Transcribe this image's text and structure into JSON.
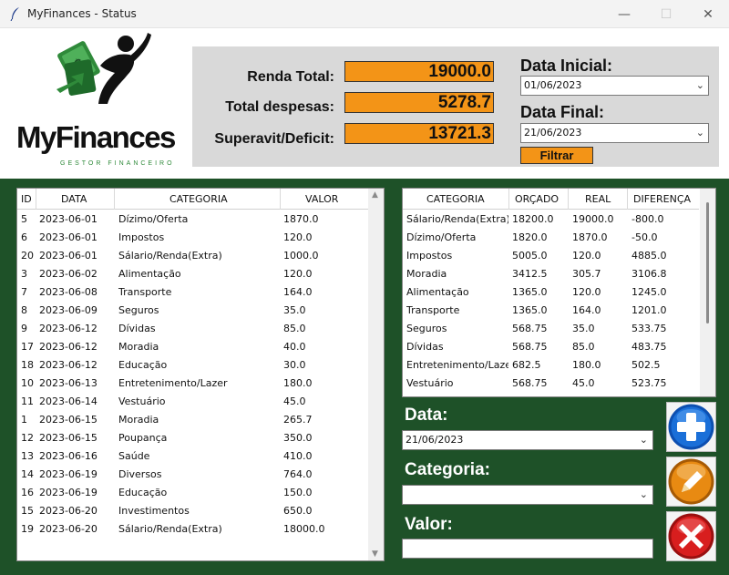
{
  "window": {
    "title": "MyFinances - Status",
    "minimize_label": "—",
    "maximize_label": "☐",
    "close_label": "✕"
  },
  "logo": {
    "name": "MyFinances",
    "tagline": "GESTOR FINANCEIRO"
  },
  "summary": {
    "renda_label": "Renda Total:",
    "renda_value": "19000.0",
    "despesas_label": "Total despesas:",
    "despesas_value": "5278.7",
    "superavit_label": "Superavit/Deficit:",
    "superavit_value": "13721.3"
  },
  "filter": {
    "data_inicial_label": "Data Inicial:",
    "data_inicial_value": "01/06/2023",
    "data_final_label": "Data Final:",
    "data_final_value": "21/06/2023",
    "filtrar_label": "Filtrar"
  },
  "transactions": {
    "headers": [
      "ID",
      "DATA",
      "CATEGORIA",
      "VALOR"
    ],
    "rows": [
      [
        "5",
        "2023-06-01",
        "Dízimo/Oferta",
        "1870.0"
      ],
      [
        "6",
        "2023-06-01",
        "Impostos",
        "120.0"
      ],
      [
        "20",
        "2023-06-01",
        "Sálario/Renda(Extra)",
        "1000.0"
      ],
      [
        "3",
        "2023-06-02",
        "Alimentação",
        "120.0"
      ],
      [
        "7",
        "2023-06-08",
        "Transporte",
        "164.0"
      ],
      [
        "8",
        "2023-06-09",
        "Seguros",
        "35.0"
      ],
      [
        "9",
        "2023-06-12",
        "Dívidas",
        "85.0"
      ],
      [
        "17",
        "2023-06-12",
        "Moradia",
        "40.0"
      ],
      [
        "18",
        "2023-06-12",
        "Educação",
        "30.0"
      ],
      [
        "10",
        "2023-06-13",
        "Entretenimento/Lazer",
        "180.0"
      ],
      [
        "11",
        "2023-06-14",
        "Vestuário",
        "45.0"
      ],
      [
        "1",
        "2023-06-15",
        "Moradia",
        "265.7"
      ],
      [
        "12",
        "2023-06-15",
        "Poupança",
        "350.0"
      ],
      [
        "13",
        "2023-06-16",
        "Saúde",
        "410.0"
      ],
      [
        "14",
        "2023-06-19",
        "Diversos",
        "764.0"
      ],
      [
        "16",
        "2023-06-19",
        "Educação",
        "150.0"
      ],
      [
        "15",
        "2023-06-20",
        "Investimentos",
        "650.0"
      ],
      [
        "19",
        "2023-06-20",
        "Sálario/Renda(Extra)",
        "18000.0"
      ]
    ]
  },
  "budget": {
    "headers": [
      "CATEGORIA",
      "ORÇADO",
      "REAL",
      "DIFERENÇA"
    ],
    "rows": [
      [
        "Sálario/Renda(Extra)",
        "18200.0",
        "19000.0",
        "-800.0"
      ],
      [
        "Dízimo/Oferta",
        "1820.0",
        "1870.0",
        "-50.0"
      ],
      [
        "Impostos",
        "5005.0",
        "120.0",
        "4885.0"
      ],
      [
        "Moradia",
        "3412.5",
        "305.7",
        "3106.8"
      ],
      [
        "Alimentação",
        "1365.0",
        "120.0",
        "1245.0"
      ],
      [
        "Transporte",
        "1365.0",
        "164.0",
        "1201.0"
      ],
      [
        "Seguros",
        "568.75",
        "35.0",
        "533.75"
      ],
      [
        "Dívidas",
        "568.75",
        "85.0",
        "483.75"
      ],
      [
        "Entretenimento/Lazer",
        "682.5",
        "180.0",
        "502.5"
      ],
      [
        "Vestuário",
        "568.75",
        "45.0",
        "523.75"
      ]
    ]
  },
  "form": {
    "data_label": "Data:",
    "data_value": "21/06/2023",
    "categoria_label": "Categoria:",
    "categoria_value": "",
    "valor_label": "Valor:",
    "valor_value": ""
  },
  "icons": {
    "add": "plus-icon",
    "edit": "pencil-icon",
    "delete": "x-icon"
  },
  "colors": {
    "brand_green": "#1e5128",
    "accent_orange": "#f39417",
    "summary_bg": "#d9d9d9",
    "add_blue": "#1a6fd8",
    "edit_orange": "#e88a12",
    "delete_red": "#d81e1e"
  }
}
